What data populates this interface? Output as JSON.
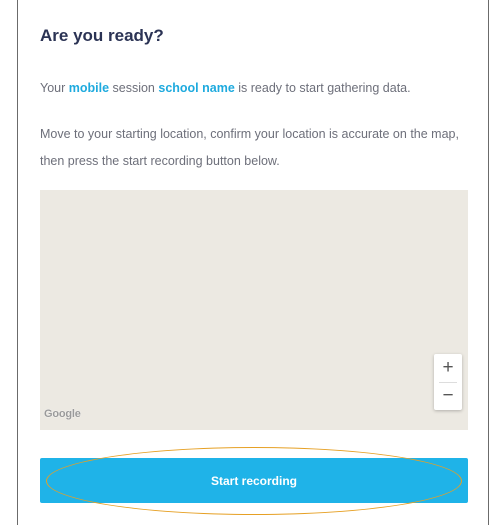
{
  "dialog": {
    "title": "Are you ready?",
    "intro": {
      "prefix": "Your ",
      "session_type": "mobile",
      "middle": " session ",
      "session_name": "school name",
      "suffix": " is ready to start gathering data."
    },
    "instructions": "Move to your starting location, confirm your location is accurate on the map, then press the start recording button below."
  },
  "map": {
    "zoom_in_label": "+",
    "zoom_out_label": "−",
    "attribution": "Google",
    "background_color": "#ece9e2"
  },
  "start_button": {
    "label": "Start recording",
    "color": "#1fb3e8"
  },
  "annotation": {
    "color": "#e6a024"
  },
  "colors": {
    "title": "#2b3354",
    "highlight": "#1eaade",
    "body_text": "#6d6f7a"
  }
}
